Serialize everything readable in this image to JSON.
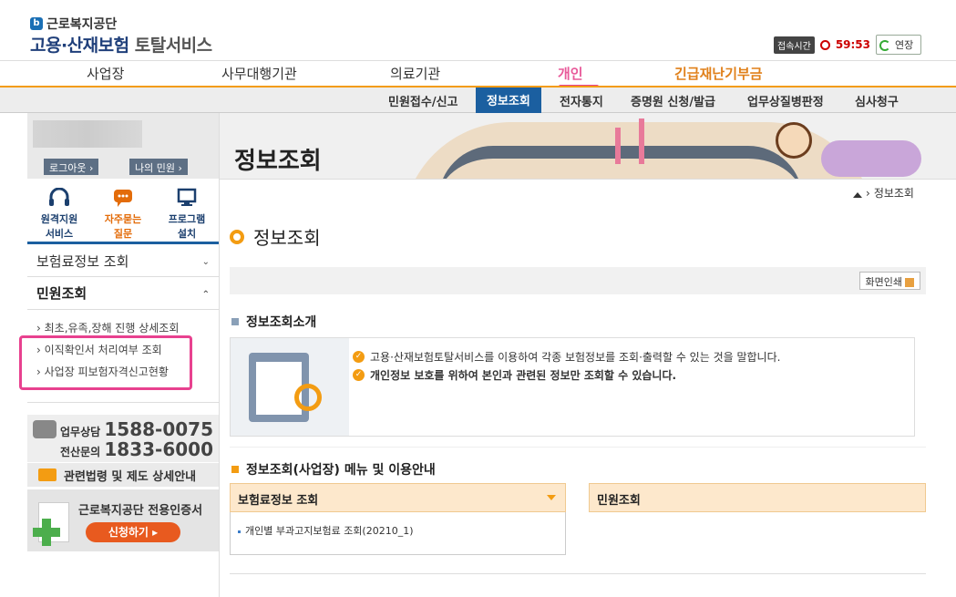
{
  "header": {
    "org_name": "근로복지공단",
    "service_title_main": "고용·산재보험",
    "service_title_sub": "토탈서비스",
    "session_label": "접속시간",
    "session_timer": "59:53",
    "extend_label": "연장"
  },
  "main_nav": {
    "items": [
      "사업장",
      "사무대행기관",
      "의료기관",
      "개인",
      "긴급재난기부금"
    ]
  },
  "sub_nav": {
    "items": [
      "민원접수/신고",
      "정보조회",
      "전자통지",
      "증명원 신청/발급",
      "업무상질병판정",
      "심사청구"
    ]
  },
  "sidebar": {
    "logout_label": "로그아웃",
    "my_label": "나의 민원",
    "quick": [
      "원격지원\n서비스",
      "자주묻는\n질문",
      "프로그램\n설치"
    ],
    "menu_insurance": "보험료정보 조회",
    "menu_civil": "민원조회",
    "submenu": [
      "최초,유족,장해 진행 상세조회",
      "이직확인서 처리여부 조회",
      "사업장 피보험자격신고현황"
    ],
    "call_label1": "업무상담",
    "call_number1": "1588-0075",
    "call_label2": "전산문의",
    "call_number2": "1833-6000",
    "law_label": "관련법령 및 제도 상세안내",
    "cert_title": "근로복지공단 전용인증서",
    "cert_button": "신청하기"
  },
  "banner": {
    "title": "정보조회"
  },
  "breadcrumb": {
    "current": "정보조회"
  },
  "page": {
    "title": "정보조회",
    "print_label": "화면인쇄",
    "intro_title": "정보조회소개",
    "intro_lines": [
      "고용·산재보험토탈서비스를 이용하여 각종 보험정보를 조회·출력할 수 있는 것을 말합니다.",
      "개인정보 보호를 위하여 본인과 관련된 정보만 조회할 수 있습니다."
    ],
    "guide_title": "정보조회(사업장) 메뉴 및 이용안내",
    "guide_left_header": "보험료정보 조회",
    "guide_right_header": "민원조회",
    "guide_left_item": "개인별 부과고지보험료 조회(20210_1)"
  },
  "colors": {
    "brand_blue": "#1b5fa0",
    "accent_orange": "#f39c12",
    "highlight_pink": "#e8418f"
  }
}
